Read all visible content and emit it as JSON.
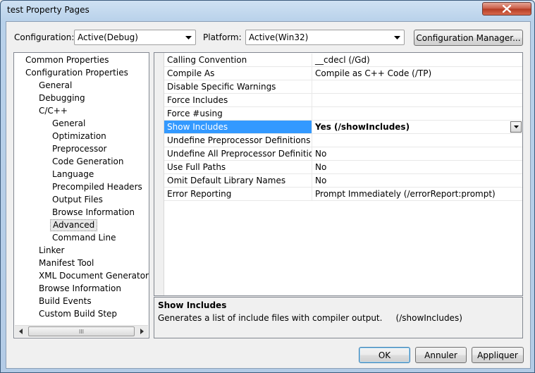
{
  "window": {
    "title": "test Property Pages"
  },
  "toolbar": {
    "configuration_label": "Configuration:",
    "configuration_value": "Active(Debug)",
    "platform_label": "Platform:",
    "platform_value": "Active(Win32)",
    "config_manager_label": "Configuration Manager..."
  },
  "tree": {
    "items": [
      {
        "label": "Common Properties",
        "level": 0
      },
      {
        "label": "Configuration Properties",
        "level": 0
      },
      {
        "label": "General",
        "level": 1
      },
      {
        "label": "Debugging",
        "level": 1
      },
      {
        "label": "C/C++",
        "level": 1
      },
      {
        "label": "General",
        "level": 2
      },
      {
        "label": "Optimization",
        "level": 2
      },
      {
        "label": "Preprocessor",
        "level": 2
      },
      {
        "label": "Code Generation",
        "level": 2
      },
      {
        "label": "Language",
        "level": 2
      },
      {
        "label": "Precompiled Headers",
        "level": 2
      },
      {
        "label": "Output Files",
        "level": 2
      },
      {
        "label": "Browse Information",
        "level": 2
      },
      {
        "label": "Advanced",
        "level": 2,
        "selected": true
      },
      {
        "label": "Command Line",
        "level": 2
      },
      {
        "label": "Linker",
        "level": 1
      },
      {
        "label": "Manifest Tool",
        "level": 1
      },
      {
        "label": "XML Document Generator",
        "level": 1
      },
      {
        "label": "Browse Information",
        "level": 1
      },
      {
        "label": "Build Events",
        "level": 1
      },
      {
        "label": "Custom Build Step",
        "level": 1
      }
    ],
    "scroll_thumb_grip": "III"
  },
  "properties": [
    {
      "name": "Calling Convention",
      "value": "__cdecl (/Gd)"
    },
    {
      "name": "Compile As",
      "value": "Compile as C++ Code (/TP)"
    },
    {
      "name": "Disable Specific Warnings",
      "value": ""
    },
    {
      "name": "Force Includes",
      "value": ""
    },
    {
      "name": "Force #using",
      "value": ""
    },
    {
      "name": "Show Includes",
      "value": "Yes (/showIncludes)",
      "selected": true
    },
    {
      "name": "Undefine Preprocessor Definitions",
      "value": ""
    },
    {
      "name": "Undefine All Preprocessor Definitions",
      "value": "No"
    },
    {
      "name": "Use Full Paths",
      "value": "No"
    },
    {
      "name": "Omit Default Library Names",
      "value": "No"
    },
    {
      "name": "Error Reporting",
      "value": "Prompt Immediately (/errorReport:prompt)"
    }
  ],
  "description": {
    "title": "Show Includes",
    "text": "Generates a list of include files with compiler output.     (/showIncludes)"
  },
  "buttons": {
    "ok": "OK",
    "cancel": "Annuler",
    "apply": "Appliquer"
  },
  "icons": {
    "close": "close-icon",
    "dropdown": "chevron-down-icon",
    "scroll_left": "scroll-left-icon",
    "scroll_right": "scroll-right-icon"
  },
  "colors": {
    "selection": "#3399ff",
    "close_button": "#c95a44"
  }
}
